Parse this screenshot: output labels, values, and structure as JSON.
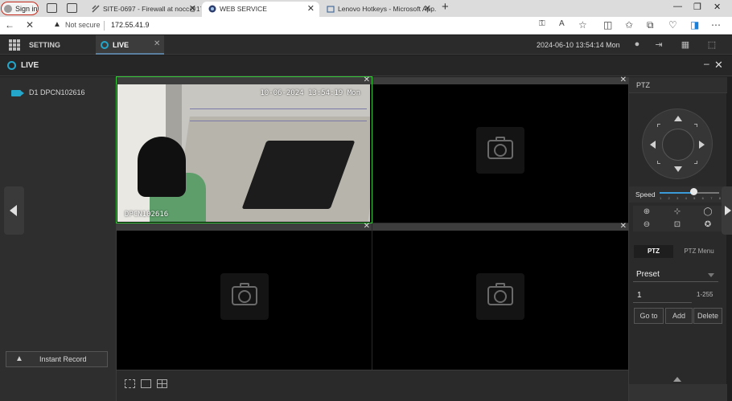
{
  "browser": {
    "signin_label": "Sign in",
    "tabs": [
      {
        "title": "SITE-0697 - Firewall at nocc@17...",
        "active": false
      },
      {
        "title": "WEB SERVICE",
        "active": true
      },
      {
        "title": "Lenovo Hotkeys - Microsoft App...",
        "active": false
      }
    ],
    "new_tab": "+",
    "security_label": "Not secure",
    "url": "172.55.41.9"
  },
  "app": {
    "setting_label": "SETTING",
    "live_tab_label": "LIVE",
    "datetime": "2024-06-10 13:54:14 Mon"
  },
  "livebar": {
    "title": "LIVE"
  },
  "sidebar": {
    "device": "D1 DPCN102616",
    "instant_record_label": "Instant Record"
  },
  "video": {
    "timestamp": "10-06-2024 13:54:19 Mon",
    "channel_name": "DPCN102616"
  },
  "ptz": {
    "title": "PTZ",
    "speed_label": "Speed",
    "speed_ticks": "1 2 3 4 5 6 7 8",
    "speed_value": 5,
    "speed_max": 8,
    "tab_ptz": "PTZ",
    "tab_menu": "PTZ Menu",
    "preset_select": "Preset",
    "preset_number": "1",
    "preset_range": "1-255",
    "goto_label": "Go to",
    "add_label": "Add",
    "delete_label": "Delete"
  },
  "colors": {
    "accent": "#23a6c9",
    "selection": "#35c93a",
    "slider": "#3b9bd8"
  }
}
